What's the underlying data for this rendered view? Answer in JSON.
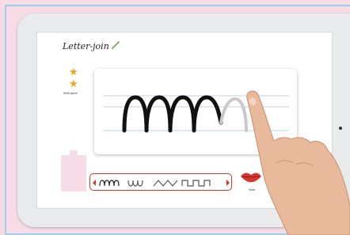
{
  "app": {
    "logo_text": "Letter-join"
  },
  "rewards": {
    "stars": 2,
    "caption": "Well done"
  },
  "practice": {
    "pattern": "m-pattern",
    "traced_letters": 4
  },
  "pattern_selector": {
    "items": [
      "m-pattern",
      "u-pattern",
      "zigzag-pattern",
      "square-pattern"
    ],
    "selected": "m-pattern"
  },
  "speak_button": {
    "label": "Sam"
  },
  "colors": {
    "accent": "#d9362b",
    "star": "#f2a514",
    "guide_line": "#b9d4e4",
    "background": "#f7dce6"
  }
}
